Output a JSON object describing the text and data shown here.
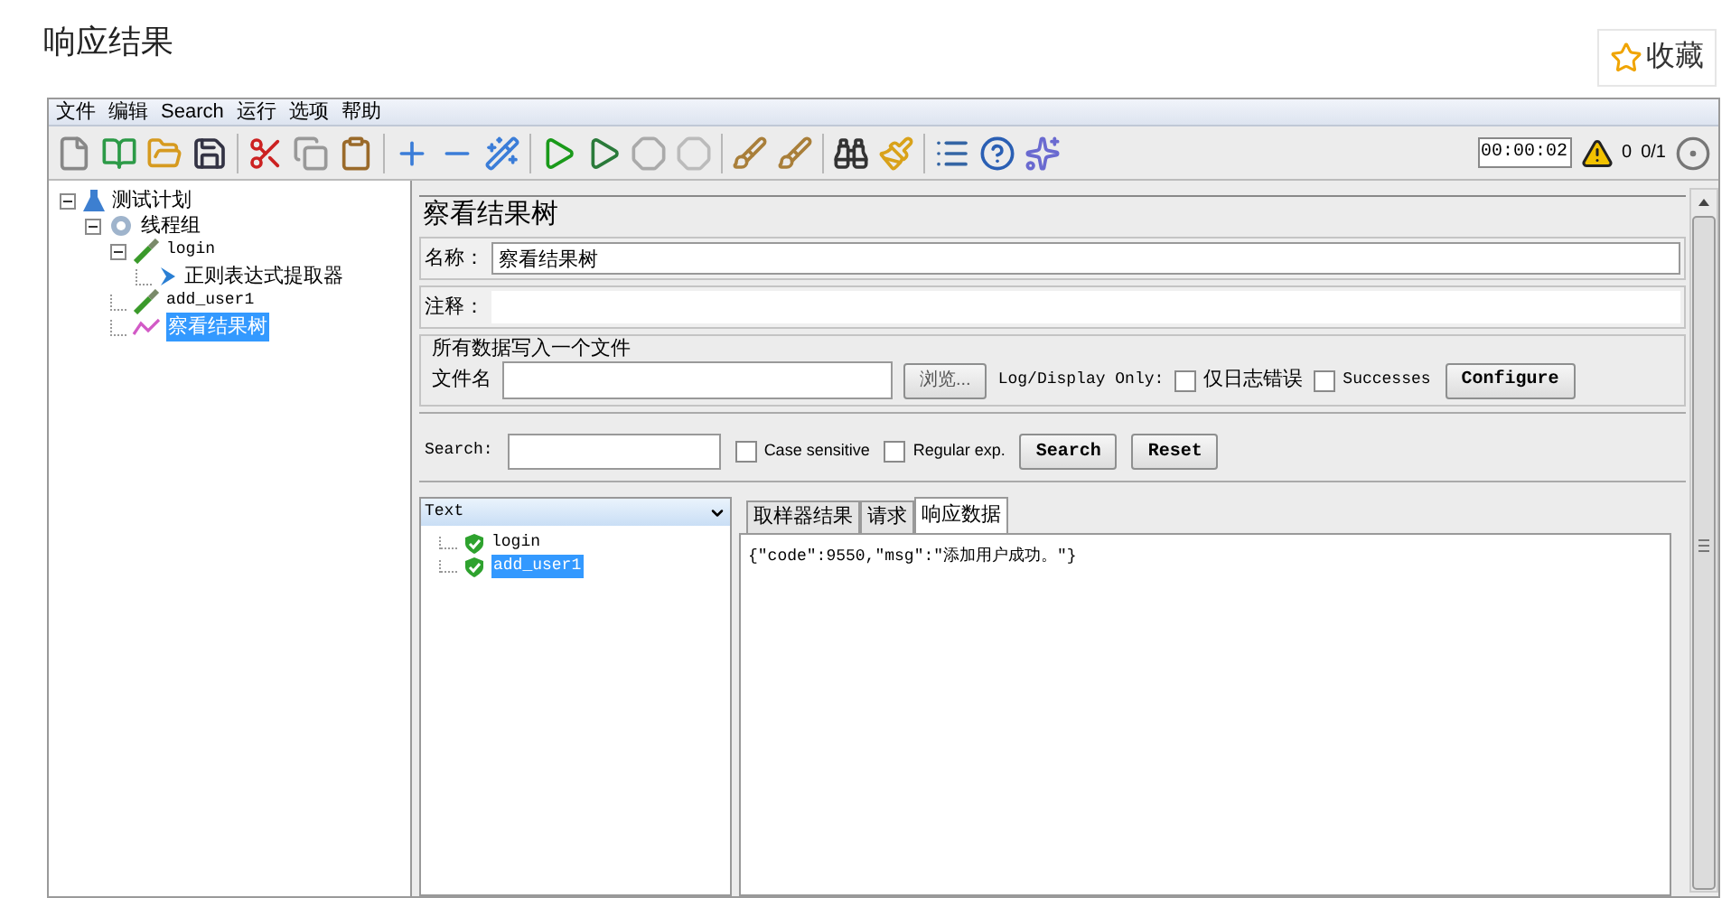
{
  "page_title": "响应结果",
  "favorite_button": {
    "label": "收藏"
  },
  "menu": [
    "文件",
    "编辑",
    "Search",
    "运行",
    "选项",
    "帮助"
  ],
  "toolbar": {
    "timer": "00:00:02",
    "warnings": "0",
    "threads": "0/1"
  },
  "test_tree": [
    {
      "label": "测试计划",
      "kind": "plan",
      "expanded": true,
      "selected": false,
      "children": [
        {
          "label": "线程组",
          "kind": "group",
          "expanded": true,
          "selected": false,
          "children": [
            {
              "label": "login",
              "kind": "sampler",
              "expanded": true,
              "selected": false,
              "children": [
                {
                  "label": "正则表达式提取器",
                  "kind": "extractor",
                  "selected": false
                }
              ]
            },
            {
              "label": "add_user1",
              "kind": "sampler",
              "selected": false
            },
            {
              "label": "察看结果树",
              "kind": "listener",
              "selected": true
            }
          ]
        }
      ]
    }
  ],
  "panel": {
    "title": "察看结果树",
    "name_label": "名称：",
    "name_value": "察看结果树",
    "comment_label": "注释：",
    "file_group": {
      "legend": "所有数据写入一个文件",
      "filename_label": "文件名",
      "browse_button": "浏览...",
      "log_label": "Log/Display Only:",
      "checkboxes": [
        {
          "label": "仅日志错误",
          "checked": false
        },
        {
          "label": "Successes",
          "checked": false
        }
      ],
      "configure_button": "Configure"
    },
    "search": {
      "label": "Search:",
      "options": [
        {
          "label": "Case sensitive",
          "checked": false
        },
        {
          "label": "Regular exp.",
          "checked": false
        }
      ],
      "search_button": "Search",
      "reset_button": "Reset"
    },
    "renderer": "Text",
    "results": [
      {
        "label": "login",
        "passed": true,
        "selected": false
      },
      {
        "label": "add_user1",
        "passed": true,
        "selected": true
      }
    ],
    "tabs": [
      {
        "label": "取样器结果",
        "selected": false
      },
      {
        "label": "请求",
        "selected": false
      },
      {
        "label": "响应数据",
        "selected": true
      }
    ],
    "response": "{\"code\":9550,\"msg\":\"添加用户成功。\"}"
  }
}
